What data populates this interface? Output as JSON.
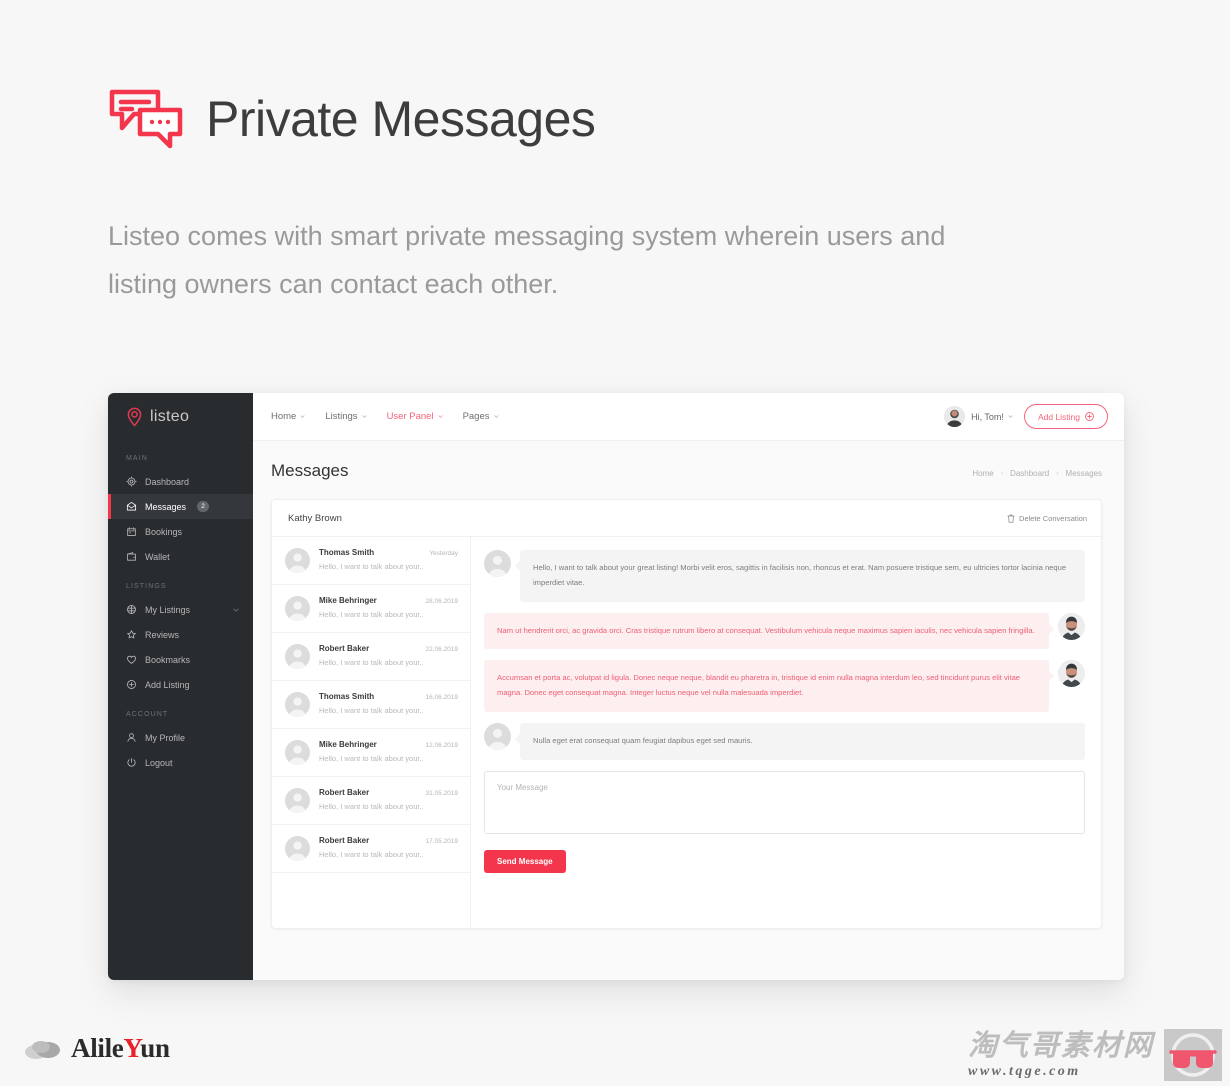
{
  "promo": {
    "icon": "chat-bubbles-icon",
    "title": "Private Messages",
    "subtitle": "Listeo comes with smart private messaging system wherein users and listing owners can contact each other."
  },
  "colors": {
    "accent": "#f4364c",
    "accent_soft": "#f4647a",
    "bubble_me_bg": "#fdeef0",
    "bubble_me_text": "#ef6074",
    "sidebar_bg": "#292c2f"
  },
  "sidebar": {
    "logo": {
      "text": "listeo",
      "icon": "map-pin-icon"
    },
    "groups": [
      {
        "label": "MAIN",
        "items": [
          {
            "label": "Dashboard",
            "icon": "dashboard-icon",
            "active": false,
            "badge": ""
          },
          {
            "label": "Messages",
            "icon": "envelope-icon",
            "active": true,
            "badge": "2"
          },
          {
            "label": "Bookings",
            "icon": "calendar-icon",
            "active": false,
            "badge": ""
          },
          {
            "label": "Wallet",
            "icon": "wallet-icon",
            "active": false,
            "badge": ""
          }
        ]
      },
      {
        "label": "LISTINGS",
        "items": [
          {
            "label": "My Listings",
            "icon": "listings-icon",
            "active": false,
            "badge": "",
            "chevron": true
          },
          {
            "label": "Reviews",
            "icon": "star-icon",
            "active": false,
            "badge": ""
          },
          {
            "label": "Bookmarks",
            "icon": "heart-icon",
            "active": false,
            "badge": ""
          },
          {
            "label": "Add Listing",
            "icon": "plus-circle-icon",
            "active": false,
            "badge": ""
          }
        ]
      },
      {
        "label": "ACCOUNT",
        "items": [
          {
            "label": "My Profile",
            "icon": "user-icon",
            "active": false,
            "badge": ""
          },
          {
            "label": "Logout",
            "icon": "power-icon",
            "active": false,
            "badge": ""
          }
        ]
      }
    ]
  },
  "topbar": {
    "nav": [
      {
        "label": "Home",
        "accent": false
      },
      {
        "label": "Listings",
        "accent": false
      },
      {
        "label": "User Panel",
        "accent": true
      },
      {
        "label": "Pages",
        "accent": false
      }
    ],
    "user_greeting": "Hi, Tom!",
    "add_listing_label": "Add Listing"
  },
  "page": {
    "title": "Messages",
    "breadcrumbs": [
      "Home",
      "Dashboard",
      "Messages"
    ]
  },
  "card": {
    "title": "Kathy Brown",
    "delete_label": "Delete Conversation"
  },
  "conversations": [
    {
      "name": "Thomas Smith",
      "date": "Yesterday",
      "preview": "Hello, I want to talk about your.."
    },
    {
      "name": "Mike Behringer",
      "date": "28.06.2019",
      "preview": "Hello, I want to talk about your.."
    },
    {
      "name": "Robert Baker",
      "date": "22.06.2019",
      "preview": "Hello, I want to talk about your.."
    },
    {
      "name": "Thomas Smith",
      "date": "16.06.2019",
      "preview": "Hello, I want to talk about your.."
    },
    {
      "name": "Mike Behringer",
      "date": "12.06.2019",
      "preview": "Hello, I want to talk about your.."
    },
    {
      "name": "Robert Baker",
      "date": "31.05.2019",
      "preview": "Hello, I want to talk about your.."
    },
    {
      "name": "Robert Baker",
      "date": "17.05.2019",
      "preview": "Hello, I want to talk about your.."
    }
  ],
  "messages": [
    {
      "from": "them",
      "text": "Hello, I want to talk about your great listing! Morbi velit eros, sagittis in facilisis non, rhoncus et erat. Nam posuere tristique sem, eu ultricies tortor lacinia neque imperdiet vitae."
    },
    {
      "from": "me",
      "text": "Nam ut hendrerit orci, ac gravida orci. Cras tristique rutrum libero at consequat. Vestibulum vehicula neque maximus sapien iaculis, nec vehicula sapien fringilla."
    },
    {
      "from": "me",
      "text": "Accumsan et porta ac, volutpat id ligula. Donec neque neque, blandit eu pharetra in, tristique id enim nulla magna interdum leo, sed tincidunt purus elit vitae magna. Donec eget consequat magna. Integer luctus neque vel nulla malesuada imperdiet."
    },
    {
      "from": "them",
      "text": "Nulla eget erat consequat quam feugiat dapibus eget sed mauris."
    }
  ],
  "compose": {
    "placeholder": "Your Message",
    "value": "",
    "send_label": "Send Message"
  },
  "watermarks": {
    "left_text_a": "Alile",
    "left_text_b": "Y",
    "left_text_c": "un",
    "right_cn": "淘气哥素材网",
    "right_url": "www.tqge.com"
  }
}
